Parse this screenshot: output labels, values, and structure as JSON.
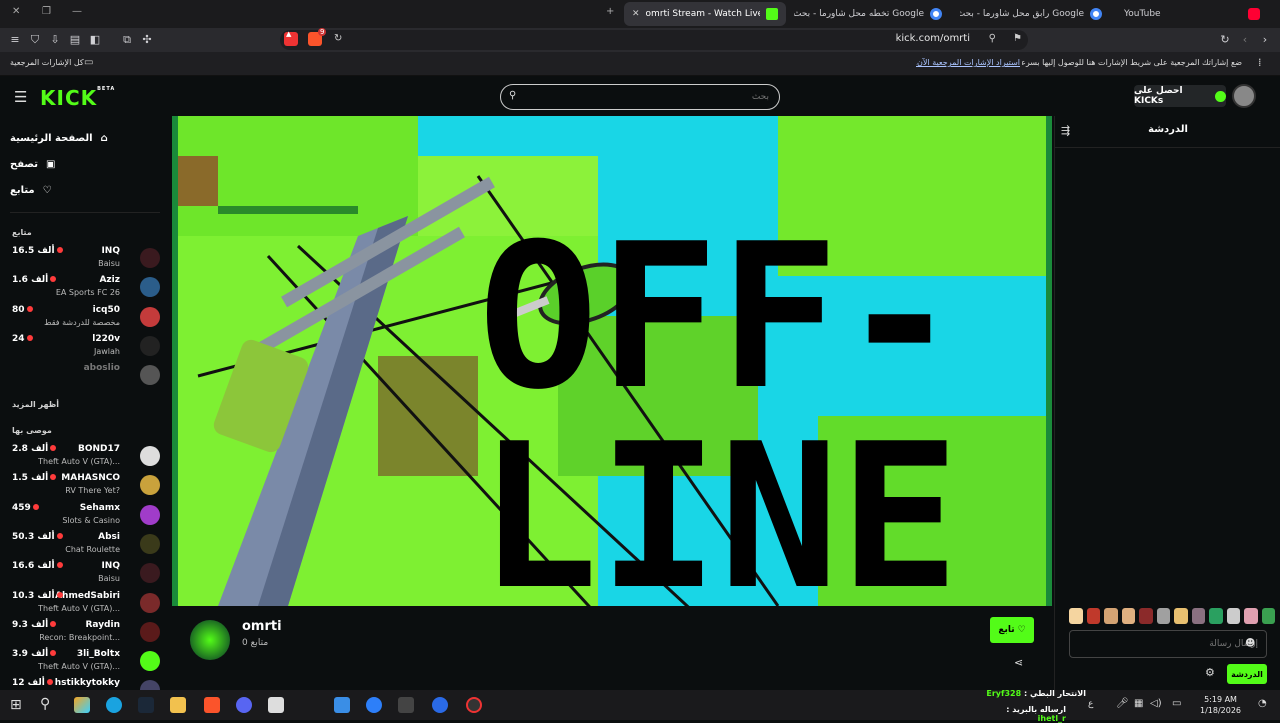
{
  "browser": {
    "tabs": [
      {
        "label": "YouTube",
        "color": "#ff0033"
      },
      {
        "label": "رابق محل شاورما - بحث Google",
        "color": "#4285f4"
      },
      {
        "label": "تخطه محل شاورما - بحث Google",
        "color": "#4285f4"
      },
      {
        "label": "omrti Stream - Watch Live on Kick",
        "color": "#53fc18"
      }
    ],
    "new_tab": "+",
    "url": "kick.com/omrti",
    "badge_count": "9",
    "bookmarks_hint": "ضع إشاراتك المرجعية على شريط الإشارات هنا للوصول إليها بسرعة.",
    "bookmarks_import": "استيراد الإشارات المرجعية الآن...",
    "all_bookmarks": "كل الإشارات المرجعية"
  },
  "header": {
    "logo": "KICK",
    "logo_beta": "BETA",
    "search_placeholder": "بحث",
    "get_kicks": "احصل على KICKs"
  },
  "sidebar": {
    "nav": [
      {
        "label": "الصفحة الرئيسية",
        "icon": "home-icon"
      },
      {
        "label": "تصفح",
        "icon": "browse-icon"
      },
      {
        "label": "متابع",
        "icon": "heart-icon"
      }
    ],
    "following_title": "متابع",
    "following": [
      {
        "name": "INQ",
        "game": "Baisu",
        "viewers": "16.5 ألف",
        "color": "#3a1a1f"
      },
      {
        "name": "Aziz",
        "game": "EA Sports FC 26",
        "viewers": "1.6 ألف",
        "color": "#2b5d8a"
      },
      {
        "name": "icq50",
        "game": "مخصصة للدردشة فقط",
        "viewers": "80",
        "color": "#c43b3b"
      },
      {
        "name": "l220v",
        "game": "Jawlah",
        "viewers": "24",
        "color": "#222"
      },
      {
        "name": "aboslio",
        "game": "",
        "viewers": "",
        "color": "#555",
        "offline": true
      }
    ],
    "show_more": "أظهر المزيد",
    "recommended_title": "موصى بها",
    "recommended": [
      {
        "name": "BOND17",
        "game": "Theft Auto V (GTA)...",
        "viewers": "2.8 ألف",
        "color": "#ddd"
      },
      {
        "name": "MAHASNCO",
        "game": "RV There Yet?",
        "viewers": "1.5 ألف",
        "color": "#c9a23c"
      },
      {
        "name": "Sehamx",
        "game": "Slots & Casino",
        "viewers": "459",
        "color": "#a03cc9"
      },
      {
        "name": "Absi",
        "game": "Chat Roulette",
        "viewers": "50.3 ألف",
        "color": "#3a3a1a"
      },
      {
        "name": "INQ",
        "game": "Baisu",
        "viewers": "16.6 ألف",
        "color": "#3a1a1f"
      },
      {
        "name": "AhmedSabiri",
        "game": "Theft Auto V (GTA)...",
        "viewers": "10.3 ألف",
        "color": "#7a2a2a"
      },
      {
        "name": "Raydin",
        "game": "Recon: Breakpoint...",
        "viewers": "9.3 ألف",
        "color": "#5a1a1a"
      },
      {
        "name": "3li_Boltx",
        "game": "Theft Auto V (GTA)...",
        "viewers": "3.9 ألف",
        "color": "#53fc18"
      },
      {
        "name": "hstikkytokky",
        "game": "",
        "viewers": "12 ألف",
        "color": "#446"
      }
    ]
  },
  "player": {
    "offline_line1": "OFF-",
    "offline_line2": "LINE"
  },
  "channel": {
    "name": "omrti",
    "followers": "0 متابع",
    "follow_label": "تابع"
  },
  "chat": {
    "title": "الدردشة",
    "input_placeholder": "إرسال رسالة",
    "send_label": "الدردشة",
    "emote_colors": [
      "#f5d5a0",
      "#c0392b",
      "#d4a373",
      "#e0b080",
      "#8b2a2a",
      "#a0a0a0",
      "#e8c070",
      "#8a7080",
      "#2aa060",
      "#ccc",
      "#e0a0b0",
      "#3aa050"
    ]
  },
  "taskbar": {
    "ticker1_user": "Eryf328",
    "ticker1_text": "الانتحار البطي :",
    "ticker2_user": "ihetl_r",
    "ticker2_text": "ارساله بالبريد :",
    "lang": "ع",
    "time": "5:19 AM",
    "date": "1/18/2026"
  }
}
